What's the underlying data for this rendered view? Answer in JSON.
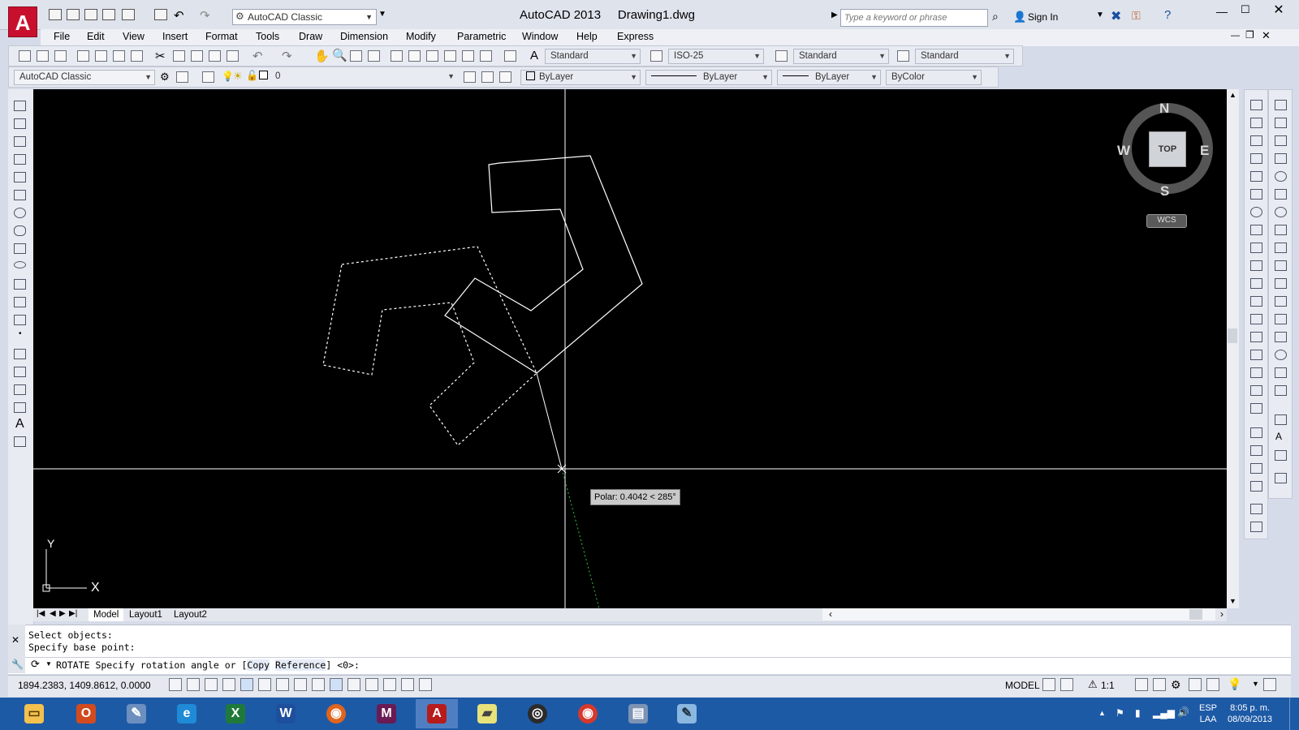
{
  "titlebar": {
    "app_name": "AutoCAD 2013",
    "document_name": "Drawing1.dwg",
    "workspace": "AutoCAD Classic",
    "search_placeholder": "Type a keyword or phrase",
    "sign_in": "Sign In"
  },
  "menubar": {
    "items": [
      "File",
      "Edit",
      "View",
      "Insert",
      "Format",
      "Tools",
      "Draw",
      "Dimension",
      "Modify",
      "Parametric",
      "Window",
      "Help",
      "Express"
    ]
  },
  "toolbar1": {
    "text_style": "Standard",
    "dim_style": "ISO-25",
    "table_style": "Standard",
    "mleader_style": "Standard"
  },
  "toolbar2": {
    "workspace": "AutoCAD Classic",
    "layer": "0",
    "color": "ByLayer",
    "linetype": "ByLayer",
    "lineweight": "ByLayer",
    "plotstyle": "ByColor"
  },
  "viewcube": {
    "face": "TOP",
    "north": "N",
    "south": "S",
    "east": "E",
    "west": "W",
    "ucs": "WCS"
  },
  "ucs_icon": {
    "x": "X",
    "y": "Y"
  },
  "tooltip": {
    "polar": "Polar: 0.4042 < 285°"
  },
  "tabs": [
    "Model",
    "Layout1",
    "Layout2"
  ],
  "command": {
    "history": [
      "Select objects:",
      "Specify base point:"
    ],
    "prompt_prefix": "ROTATE Specify rotation angle or [",
    "opt_copy": "Copy",
    "opt_reference": "Reference",
    "prompt_suffix": "] <0>:"
  },
  "statusbar": {
    "coords": "1894.2383, 1409.8612, 0.0000",
    "model": "MODEL",
    "scale": "1:1"
  },
  "tray": {
    "lang1": "ESP",
    "lang2": "LAA",
    "time": "8:05 p. m.",
    "date": "08/09/2013"
  },
  "colors": {
    "canvas": "#000000",
    "taskbar": "#1d5aa6",
    "drawing": "#ffffff"
  }
}
